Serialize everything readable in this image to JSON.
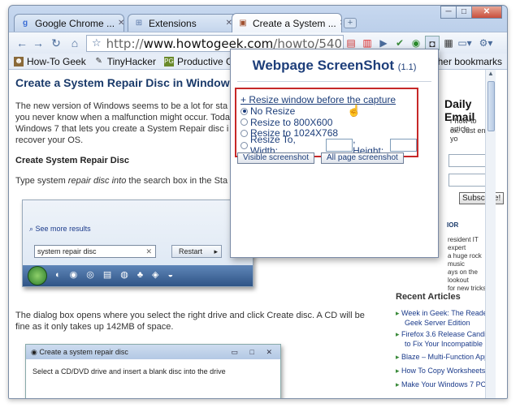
{
  "tabs": [
    {
      "label": "Google Chrome ...",
      "icon": "google-icon"
    },
    {
      "label": "Extensions",
      "icon": "puzzle-icon"
    },
    {
      "label": "Create a System ...",
      "icon": "page-icon"
    }
  ],
  "window_controls": {
    "minimize": "─",
    "maximize": "□",
    "close": "✕"
  },
  "toolbar": {
    "url_prefix": "http://",
    "url_domain": "www.howtogeek.com",
    "url_path": "/howto/5409/create"
  },
  "bookmarks": [
    {
      "label": "How-To Geek",
      "icon": "hat-icon"
    },
    {
      "label": "TinyHacker",
      "icon": "hacker-icon"
    },
    {
      "label": "Productive G...",
      "icon": "pg-icon"
    }
  ],
  "other_bookmarks": "her bookmarks",
  "article": {
    "title": "Create a System Repair Disc in Windows 7",
    "para1_line1": "The new version of Windows seems to be a lot for sta",
    "para1_line2": "you never know when a malfunction might occur. Toda",
    "para1_line3": "Windows 7 that lets you create a System Repair disc i",
    "para1_line4": "recover your OS.",
    "subheading": "Create System Repair Disc",
    "para2_start": "Type system ",
    "para2_em": "repair disc into",
    "para2_end": " the search box in the Sta",
    "shot1_see_more": "See more results",
    "shot1_search_value": "system repair disc",
    "shot1_restart": "Restart",
    "para3_line1": "The dialog box opens where you select the right drive and click Create disc. A CD will be",
    "para3_line2": "fine as it only takes up 142MB of space.",
    "shot2_title": "Create a system repair disc",
    "shot2_text": "Select a CD/DVD drive and insert a blank disc into the drive"
  },
  "sidebar": {
    "daily_email": "Daily Email",
    "line1": "r how-to article",
    "line2": "ox. Just enter yo",
    "subscribe": "Subscribe!",
    "author_label": "IOR",
    "author1": "resident IT expert",
    "author2": "a huge rock music",
    "author3": "ays on the lookout",
    "author4": "for new tricks.",
    "recent_title": "Recent Articles",
    "recent": [
      "Week in Geek: The Reader Tips an",
      "Geek Server Edition",
      "Firefox 3.6 Release Candidate Av",
      "to Fix Your Incompatible Extension",
      "Blaze – Multi-Function Application",
      "How To Copy Worksheets in Exce",
      "Make Your Windows 7 PC Not Shu"
    ]
  },
  "popup": {
    "title": "Webpage ScreenShot",
    "version": "(1.1)",
    "resize_link": "+ Resize window before the capture",
    "options": [
      "No Resize",
      "Resize to 800X600",
      "Resize to 1024X768"
    ],
    "custom_label": "Resize To, Width:",
    "height_label": ", Height:",
    "width_value": "",
    "height_value": "",
    "selected_option": "No Resize",
    "visible_button": "Visible screenshot",
    "all_button": "All page screenshot"
  }
}
